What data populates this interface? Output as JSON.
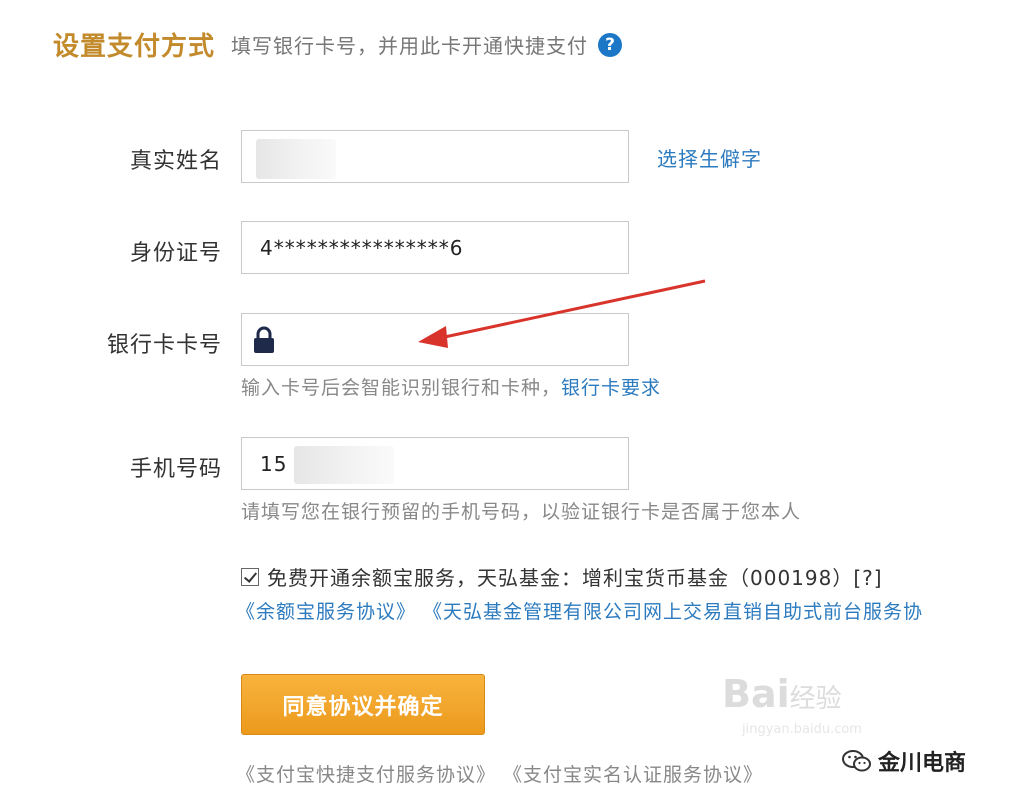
{
  "header": {
    "title": "设置支付方式",
    "subtitle": "填写银行卡号，并用此卡开通快捷支付",
    "help_icon": "question-icon",
    "help_text": "?"
  },
  "form": {
    "name": {
      "label": "真实姓名",
      "link": "选择生僻字"
    },
    "id_number": {
      "label": "身份证号",
      "value": "4****************6"
    },
    "bank_card": {
      "label": "银行卡卡号",
      "lock_icon": "lock-icon",
      "hint": "输入卡号后会智能识别银行和卡种，",
      "hint_link": "银行卡要求"
    },
    "phone": {
      "label": "手机号码",
      "value": "15",
      "hint": "请填写您在银行预留的手机号码，以验证银行卡是否属于您本人"
    }
  },
  "agreement": {
    "checked": true,
    "text": "免费开通余额宝服务，天弘基金：增利宝货币基金（000198）[?]",
    "links": "《余额宝服务协议》 《天弘基金管理有限公司网上交易直销自助式前台服务协"
  },
  "submit": {
    "label": "同意协议并确定"
  },
  "footer": {
    "links": "《支付宝快捷支付服务协议》   《支付宝实名认证服务协议》"
  },
  "watermark": {
    "text": "Bai",
    "suffix": "经验",
    "url": "jingyan.baidu.com"
  },
  "brand": {
    "icon": "wechat-icon",
    "name": "金川电商"
  },
  "colors": {
    "accent": "#c28a2a",
    "link": "#2d7bbf",
    "button": "#f0a32a",
    "help": "#1c78c7"
  }
}
